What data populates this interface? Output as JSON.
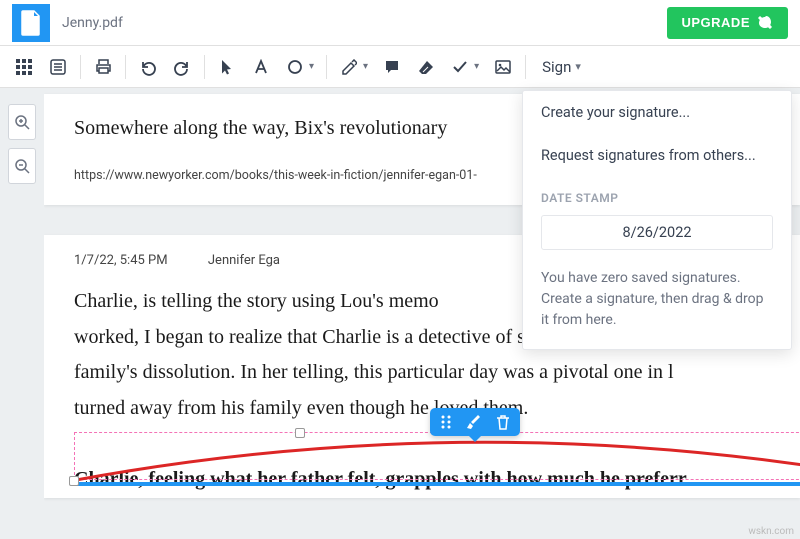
{
  "header": {
    "filename": "Jenny.pdf",
    "upgrade": "UPGRADE"
  },
  "toolbar": {
    "sign": "Sign"
  },
  "signMenu": {
    "create": "Create your signature...",
    "request": "Request signatures from others...",
    "dateLabel": "DATE STAMP",
    "date": "8/26/2022",
    "info": "You have zero saved signatures. Create a signature, then drag & drop it from here."
  },
  "page1": {
    "line": "Somewhere along the way, Bix's revolutionary",
    "url": "https://www.newyorker.com/books/this-week-in-fiction/jennifer-egan-01-"
  },
  "page2": {
    "timestamp": "1/7/22, 5:45 PM",
    "author": "Jennifer Ega",
    "p1": "Charlie, is telling the story using Lou's memo",
    "p2": "worked, I began to realize that Charlie is a detective of sorts: she's searchin",
    "p3": "family's dissolution. In her telling, this particular day was a pivotal one in l",
    "p4": "turned away from his family even though he loved them.",
    "p5": "Charlie, feeling what her father felt, grapples with how much he preferr"
  },
  "watermark": "wskn.com"
}
